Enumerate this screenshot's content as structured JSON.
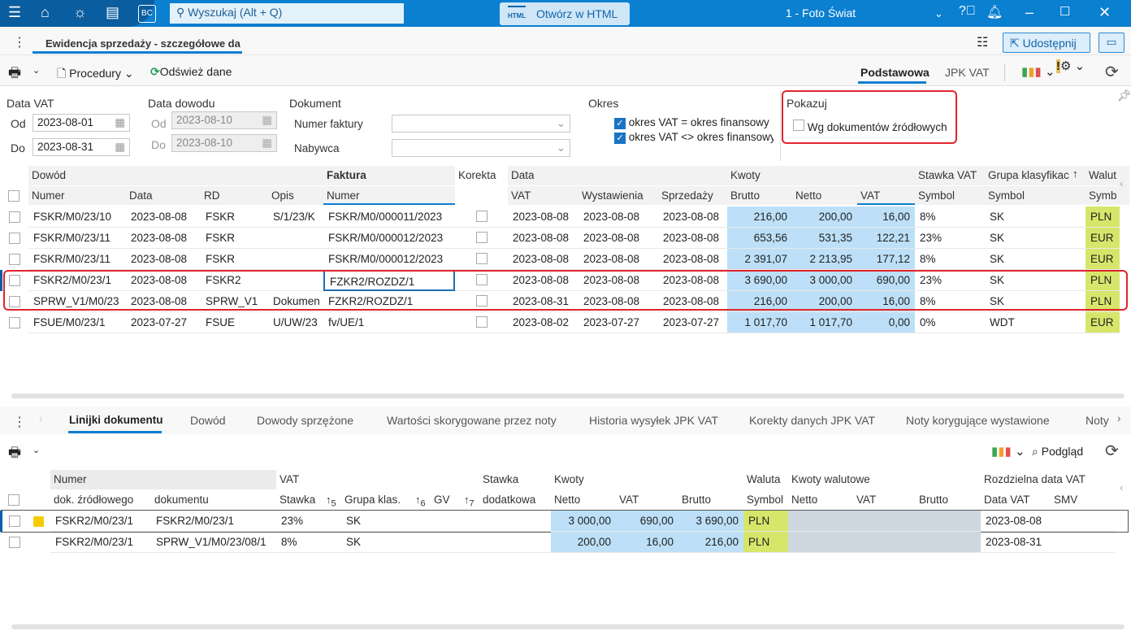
{
  "topbar": {
    "search_placeholder": "Wyszukaj (Alt + Q)",
    "html_button": "Otwórz w HTML",
    "title": "1 - Foto Świat",
    "bc_label": "BC"
  },
  "tabrow": {
    "tab": "Ewidencja sprzedaży - szczegółowe da",
    "share": "Udostępnij"
  },
  "toolbar": {
    "procedures": "Procedury",
    "refresh": "Odśwież dane",
    "view_basic": "Podstawowa",
    "view_jpk": "JPK VAT"
  },
  "filters": {
    "date_vat": {
      "label": "Data VAT",
      "from_label": "Od",
      "from": "2023-08-01",
      "to_label": "Do",
      "to": "2023-08-31"
    },
    "date_doc": {
      "label": "Data dowodu",
      "from_label": "Od",
      "from": "2023-08-10",
      "to_label": "Do",
      "to": "2023-08-10"
    },
    "document": {
      "label": "Dokument",
      "invoice_label": "Numer faktury",
      "invoice": "",
      "buyer_label": "Nabywca",
      "buyer": ""
    },
    "period": {
      "label": "Okres",
      "opt1": "okres VAT = okres finansowy",
      "opt1_checked": true,
      "opt2": "okres VAT <> okres finansowy",
      "opt2_checked": true
    },
    "show": {
      "label": "Pokazuj",
      "opt": "Wg dokumentów źródłowych",
      "opt_checked": false
    }
  },
  "main_grid": {
    "groups": [
      "Dowód",
      "Faktura",
      "Korekta",
      "Data",
      "Kwoty",
      "Stawka VAT",
      "Grupa klasyfikac",
      "Walut"
    ],
    "columns": [
      "Numer",
      "Data",
      "RD",
      "Opis",
      "Numer",
      "",
      "VAT",
      "Wystawienia",
      "Sprzedaży",
      "Brutto",
      "Netto",
      "VAT",
      "Symbol",
      "Symbol",
      "Symb"
    ],
    "rows": [
      [
        "FSKR/M0/23/10",
        "2023-08-08",
        "FSKR",
        "S/1/23/K",
        "FSKR/M0/000011/2023",
        "",
        "2023-08-08",
        "2023-08-08",
        "2023-08-08",
        "216,00",
        "200,00",
        "16,00",
        "8%",
        "SK",
        "PLN"
      ],
      [
        "FSKR/M0/23/11",
        "2023-08-08",
        "FSKR",
        "",
        "FSKR/M0/000012/2023",
        "",
        "2023-08-08",
        "2023-08-08",
        "2023-08-08",
        "653,56",
        "531,35",
        "122,21",
        "23%",
        "SK",
        "EUR"
      ],
      [
        "FSKR/M0/23/11",
        "2023-08-08",
        "FSKR",
        "",
        "FSKR/M0/000012/2023",
        "",
        "2023-08-08",
        "2023-08-08",
        "2023-08-08",
        "2 391,07",
        "2 213,95",
        "177,12",
        "8%",
        "SK",
        "EUR"
      ],
      [
        "FSKR2/M0/23/1",
        "2023-08-08",
        "FSKR2",
        "",
        "FZKR2/ROZDZ/1",
        "",
        "2023-08-08",
        "2023-08-08",
        "2023-08-08",
        "3 690,00",
        "3 000,00",
        "690,00",
        "23%",
        "SK",
        "PLN"
      ],
      [
        "SPRW_V1/M0/23",
        "2023-08-08",
        "SPRW_V1",
        "Dokumen",
        "FZKR2/ROZDZ/1",
        "",
        "2023-08-31",
        "2023-08-08",
        "2023-08-08",
        "216,00",
        "200,00",
        "16,00",
        "8%",
        "SK",
        "PLN"
      ],
      [
        "FSUE/M0/23/1",
        "2023-07-27",
        "FSUE",
        "U/UW/23",
        "fv/UE/1",
        "",
        "2023-08-02",
        "2023-07-27",
        "2023-07-27",
        "1 017,70",
        "1 017,70",
        "0,00",
        "0%",
        "WDT",
        "EUR"
      ]
    ],
    "selected_row": 3
  },
  "bottom_tabs": [
    "Linijki dokumentu",
    "Dowód",
    "Dowody sprzężone",
    "Wartości skorygowane przez noty",
    "Historia wysyłek JPK VAT",
    "Korekty danych JPK VAT",
    "Noty korygujące wystawione",
    "Noty"
  ],
  "bottom_toolbar": {
    "preview": "Podgląd"
  },
  "lines_grid": {
    "groups": [
      "Numer",
      "VAT",
      "Stawka",
      "Kwoty",
      "Waluta",
      "Kwoty walutowe",
      "Rozdzielna data VAT"
    ],
    "columns": [
      "dok. źródłowego",
      "dokumentu",
      "Stawka",
      "5",
      "Grupa klas.",
      "6",
      "GV",
      "7",
      "dodatkowa",
      "Netto",
      "VAT",
      "Brutto",
      "Symbol",
      "Netto",
      "VAT",
      "Brutto",
      "Data VAT",
      "SMV"
    ],
    "rows": [
      [
        "FSKR2/M0/23/1",
        "FSKR2/M0/23/1",
        "23%",
        "",
        "SK",
        "",
        "",
        "",
        "",
        "3 000,00",
        "690,00",
        "3 690,00",
        "PLN",
        "",
        "",
        "",
        "2023-08-08",
        ""
      ],
      [
        "FSKR2/M0/23/1",
        "SPRW_V1/M0/23/08/1",
        "8%",
        "",
        "SK",
        "",
        "",
        "",
        "",
        "200,00",
        "16,00",
        "216,00",
        "PLN",
        "",
        "",
        "",
        "2023-08-31",
        ""
      ]
    ],
    "colors": {
      "row_marker": "#f5cc00"
    }
  }
}
